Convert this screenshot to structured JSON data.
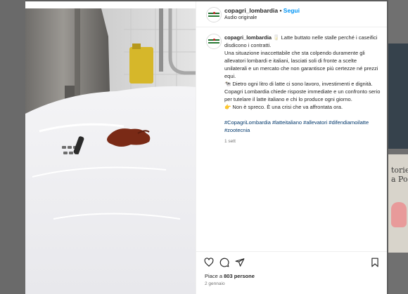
{
  "post": {
    "username": "copagri_lombardia",
    "separator": "•",
    "follow_label": "Segui",
    "audio_label": "Audio originale",
    "caption": {
      "username": "copagri_lombardia",
      "lines": [
        "🥛 Latte buttato nelle stalle perché i caseifici disdicono i contratti.",
        "Una situazione inaccettabile che sta colpendo duramente gli allevatori lombardi e italiani, lasciati soli di fronte a scelte unilaterali e un mercato che non garantisce più certezze né prezzi equi.",
        "🐄 Dietro ogni litro di latte ci sono lavoro, investimenti e dignità.",
        "Copagri Lombardia chiede risposte immediate e un confronto serio per tutelare il latte italiano e chi lo produce ogni giorno.",
        "👉 Non è spreco. È una crisi che va affrontata ora."
      ],
      "hashtags": "#CopagriLombardia #latteitaliano #allevatori #difendiamoilatte #zootecnia",
      "time": "1 sett"
    },
    "likes_prefix": "Piace a ",
    "likes_count": "803 persone",
    "date": "2 gennaio"
  },
  "background": {
    "right_card_text": "torie\na Por"
  },
  "icons": {
    "like": "heart-icon",
    "comment": "comment-icon",
    "share": "send-icon",
    "save": "bookmark-icon"
  },
  "colors": {
    "link": "#0095f6",
    "hashtag": "#00376b",
    "muted": "#737373",
    "text": "#262626"
  }
}
